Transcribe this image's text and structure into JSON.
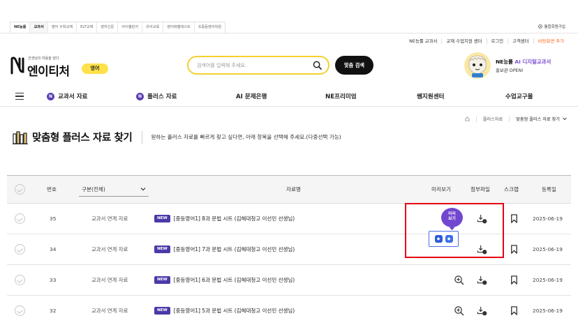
{
  "site_tabs": [
    "NE능률",
    "교과서",
    "영어 수학교재",
    "ELT교재",
    "영자신문",
    "아이챌린지",
    "유아교육",
    "영어레벨테스트",
    "초중등영어학원"
  ],
  "member_button": "통합회원가입",
  "utility_links": [
    "NE능률 교과서",
    "교재 수업지원 센터",
    "로그인",
    "고객센터",
    "바탕화면 추가"
  ],
  "logo": {
    "tagline": "선생님의 마음을 담다",
    "name": "엔이티처",
    "badge": "영어"
  },
  "search": {
    "placeholder": "검색어를 입력해 주세요.",
    "button": "맞춤 검색"
  },
  "promo": {
    "brand": "NE능률",
    "highlight": "AI 디지털교과서",
    "subtitle": "홍보관 OPEN!"
  },
  "nav": [
    {
      "badge": "N",
      "label": "교과서 자료"
    },
    {
      "badge": "N",
      "label": "플러스 자료"
    },
    {
      "badge": "",
      "label": "AI 문제은행"
    },
    {
      "badge": "",
      "label": "NE프리미엄"
    },
    {
      "badge": "",
      "label": "쌤지원센터"
    },
    {
      "badge": "",
      "label": "수업교구몰"
    }
  ],
  "breadcrumb": {
    "section": "플러스자료",
    "current": "맞춤형 플러스 자료 찾기"
  },
  "page": {
    "title": "맞춤형 플러스 자료 찾기",
    "description": "원하는 플러스 자료를 빠르게 찾고 싶다면, 아래 항목을 선택해 주세요.(다중선택 가능)"
  },
  "table": {
    "headers": {
      "number": "번호",
      "category": "구분(전체)",
      "title": "자료명",
      "preview": "미리보기",
      "attachment": "첨부파일",
      "scrap": "스크랩",
      "date": "등록일"
    },
    "new_label": "NEW",
    "rows": [
      {
        "number": "35",
        "category": "교과서 연계 자료",
        "title": "[중등영어1] 8과 문법 시트 (김해대청고 이선민 선생님)",
        "date": "2025-06-19",
        "attachment_count": "2"
      },
      {
        "number": "34",
        "category": "교과서 연계 자료",
        "title": "[중등영어1] 7과 문법 시트 (김해대청고 이선민 선생님)",
        "date": "2025-06-19",
        "attachment_count": "2"
      },
      {
        "number": "33",
        "category": "교과서 연계 자료",
        "title": "[중등영어1] 6과 문법 시트 (김해대청고 이선민 선생님)",
        "date": "2025-06-19",
        "attachment_count": "2"
      },
      {
        "number": "32",
        "category": "교과서 연계 자료",
        "title": "[중등영어1] 5과 문법 시트 (김해대청고 이선민 선생님)",
        "date": "2025-06-19",
        "attachment_count": "2"
      }
    ]
  },
  "preview_bubble": {
    "line1": "미리",
    "line2": "보기"
  },
  "colors": {
    "accent_purple": "#5b3fb5",
    "search_border": "#f2d230",
    "highlight_red": "#e60012",
    "new_badge": "#4a3aa8"
  }
}
